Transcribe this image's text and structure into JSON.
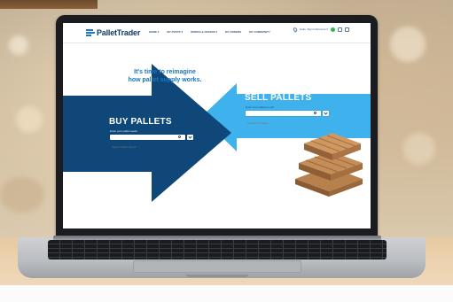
{
  "site": {
    "logo_text": "PalletTrader",
    "nav": [
      "HOME ▾",
      "MY POSTS ▾",
      "WORKS & OFFERS ▾",
      "MY ORDERS",
      "MY COMMUNITY"
    ],
    "account_text": "Hello, Sign In/Account ▾"
  },
  "hero": {
    "headline_line1": "It's time to reimagine",
    "headline_line2": "how pallet supply works."
  },
  "buy": {
    "title": "BUY PALLETS",
    "subtitle": "Enter your pallet needs",
    "search_placeholder": "Search Pallet Needs"
  },
  "sell": {
    "title": "SELL PALLETS",
    "subtitle": "Enter your pallets to sell",
    "search_placeholder": "Search for Pallets"
  },
  "colors": {
    "buy_arrow": "#0e4778",
    "sell_arrow": "#3fb2ee",
    "headline": "#1976c2"
  },
  "icons": {
    "search": "search-icon",
    "location": "location-pin-icon",
    "notification": "notification-dot-icon",
    "cart": "cart-icon"
  }
}
